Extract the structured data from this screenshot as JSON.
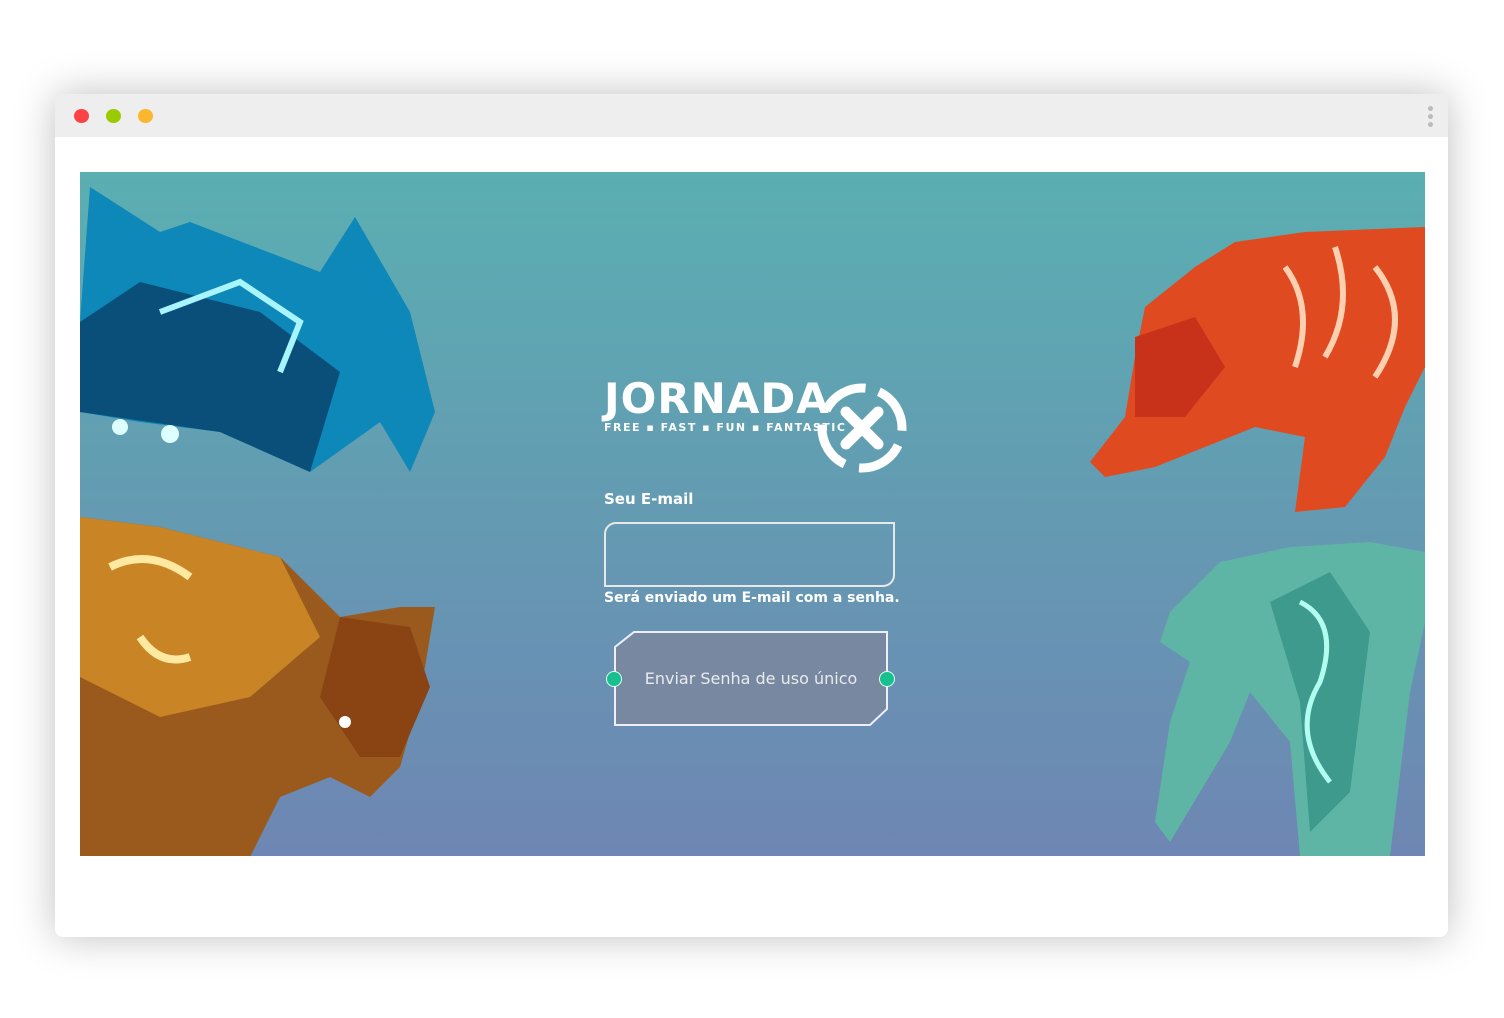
{
  "window": {
    "controls": {
      "close_color": "#fc4245",
      "minimize_color": "#9acb00",
      "maximize_color": "#fdb72f"
    }
  },
  "logo": {
    "word": "JORNADA",
    "tagline": "FREE ▪ FAST ▪ FUN ▪ FANTASTIC",
    "mark": "X"
  },
  "form": {
    "email_label": "Seu E-mail",
    "email_value": "",
    "email_placeholder": "",
    "help_text": "Será enviado um E-mail com a senha.",
    "submit_label": "Enviar Senha de uso único"
  },
  "colors": {
    "bg_top": "#5aafb2",
    "bg_bottom": "#6e86b3",
    "accent": "#17c08e"
  }
}
